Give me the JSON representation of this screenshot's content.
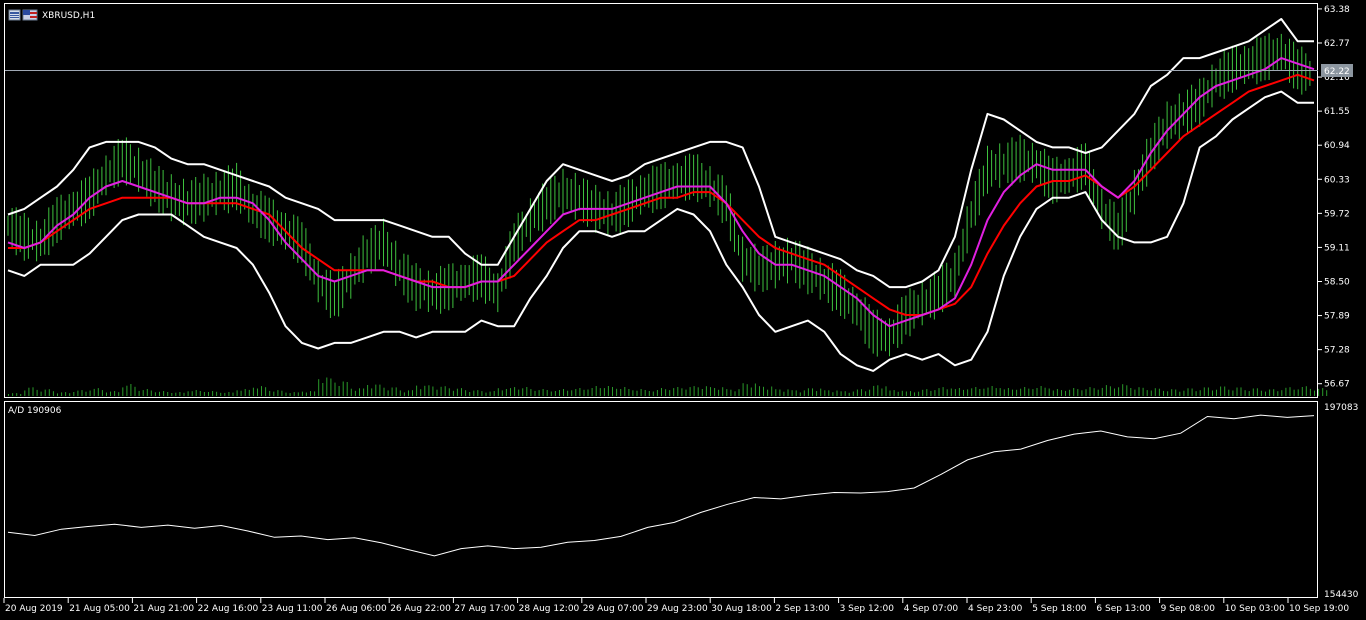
{
  "window": {
    "title": "XBRUSD,H1",
    "icon_left": "chart-window-icon",
    "icon_right": "chart-window-icon"
  },
  "price_panel": {
    "current_price_label": "62.22",
    "y_ticks": [
      "63.38",
      "62.77",
      "62.16",
      "61.55",
      "60.94",
      "60.33",
      "59.72",
      "59.11",
      "58.50",
      "57.89",
      "57.28",
      "56.67"
    ],
    "y_range": [
      56.45,
      63.45
    ]
  },
  "indicator_panel": {
    "label": "A/D 190906",
    "y_top": "197083",
    "y_bottom": "154430"
  },
  "x_axis": {
    "labels": [
      "20 Aug 2019",
      "21 Aug 05:00",
      "21 Aug 21:00",
      "22 Aug 16:00",
      "23 Aug 11:00",
      "26 Aug 06:00",
      "26 Aug 22:00",
      "27 Aug 17:00",
      "28 Aug 12:00",
      "29 Aug 07:00",
      "29 Aug 23:00",
      "30 Aug 18:00",
      "2 Sep 13:00",
      "3 Sep 12:00",
      "4 Sep 07:00",
      "4 Sep 23:00",
      "5 Sep 18:00",
      "6 Sep 13:00",
      "9 Sep 08:00",
      "10 Sep 03:00",
      "10 Sep 19:00"
    ]
  },
  "colors": {
    "background": "#000000",
    "candle": "#3ec13e",
    "bollinger": "#ffffff",
    "ma_fast": "#e020e0",
    "ma_slow": "#ff0000",
    "volume": "#2a9a2a",
    "grid_line": "#9fa8b4",
    "price_tag": "#8c96a0",
    "text": "#ffffff"
  },
  "chart_data": {
    "type": "line",
    "symbol": "XBRUSD",
    "timeframe": "H1",
    "close": [
      59.5,
      59.3,
      59.2,
      59.6,
      59.8,
      60.0,
      60.4,
      60.7,
      60.5,
      60.2,
      60.0,
      59.9,
      60.0,
      60.1,
      60.2,
      59.8,
      59.6,
      59.4,
      59.2,
      58.5,
      58.2,
      58.6,
      59.0,
      59.2,
      58.7,
      58.4,
      58.3,
      58.4,
      58.5,
      58.6,
      58.3,
      59.2,
      59.6,
      59.9,
      60.1,
      60.0,
      59.8,
      59.7,
      59.9,
      60.1,
      60.2,
      60.3,
      60.4,
      60.2,
      59.9,
      58.9,
      58.7,
      58.8,
      58.9,
      58.7,
      58.5,
      58.3,
      58.0,
      57.6,
      57.5,
      57.9,
      58.1,
      58.3,
      58.6,
      59.7,
      60.5,
      60.6,
      60.7,
      60.6,
      60.3,
      60.4,
      60.6,
      59.8,
      59.4,
      60.1,
      60.8,
      61.3,
      61.5,
      61.7,
      62.1,
      62.3,
      62.4,
      62.5,
      62.6,
      62.3,
      62.2
    ],
    "bollinger_upper": [
      59.7,
      59.8,
      60.0,
      60.2,
      60.5,
      60.9,
      61.0,
      61.0,
      61.0,
      60.9,
      60.7,
      60.6,
      60.6,
      60.5,
      60.4,
      60.3,
      60.2,
      60.0,
      59.9,
      59.8,
      59.6,
      59.6,
      59.6,
      59.6,
      59.5,
      59.4,
      59.3,
      59.3,
      59.0,
      58.8,
      58.8,
      59.3,
      59.8,
      60.3,
      60.6,
      60.5,
      60.4,
      60.3,
      60.4,
      60.6,
      60.7,
      60.8,
      60.9,
      61.0,
      61.0,
      60.9,
      60.2,
      59.3,
      59.2,
      59.1,
      59.0,
      58.9,
      58.7,
      58.6,
      58.4,
      58.4,
      58.5,
      58.7,
      59.3,
      60.5,
      61.5,
      61.4,
      61.2,
      61.0,
      60.9,
      60.9,
      60.8,
      60.9,
      61.2,
      61.5,
      62.0,
      62.2,
      62.5,
      62.5,
      62.6,
      62.7,
      62.8,
      63.0,
      63.2,
      62.8,
      62.8
    ],
    "bollinger_lower": [
      58.7,
      58.6,
      58.8,
      58.8,
      58.8,
      59.0,
      59.3,
      59.6,
      59.7,
      59.7,
      59.7,
      59.5,
      59.3,
      59.2,
      59.1,
      58.8,
      58.3,
      57.7,
      57.4,
      57.3,
      57.4,
      57.4,
      57.5,
      57.6,
      57.6,
      57.5,
      57.6,
      57.6,
      57.6,
      57.8,
      57.7,
      57.7,
      58.2,
      58.6,
      59.1,
      59.4,
      59.4,
      59.3,
      59.4,
      59.4,
      59.6,
      59.8,
      59.7,
      59.4,
      58.8,
      58.4,
      57.9,
      57.6,
      57.7,
      57.8,
      57.6,
      57.2,
      57.0,
      56.9,
      57.1,
      57.2,
      57.1,
      57.2,
      57.0,
      57.1,
      57.6,
      58.6,
      59.3,
      59.8,
      60.0,
      60.0,
      60.1,
      59.6,
      59.3,
      59.2,
      59.2,
      59.3,
      59.9,
      60.9,
      61.1,
      61.4,
      61.6,
      61.8,
      61.9,
      61.7,
      61.7
    ],
    "ma_fast": [
      59.2,
      59.1,
      59.2,
      59.5,
      59.7,
      60.0,
      60.2,
      60.3,
      60.2,
      60.1,
      60.0,
      59.9,
      59.9,
      60.0,
      60.0,
      59.9,
      59.6,
      59.2,
      58.9,
      58.6,
      58.5,
      58.6,
      58.7,
      58.7,
      58.6,
      58.5,
      58.4,
      58.4,
      58.4,
      58.5,
      58.5,
      58.8,
      59.1,
      59.4,
      59.7,
      59.8,
      59.8,
      59.8,
      59.9,
      60.0,
      60.1,
      60.2,
      60.2,
      60.2,
      59.9,
      59.4,
      59.0,
      58.8,
      58.8,
      58.7,
      58.6,
      58.4,
      58.2,
      57.9,
      57.7,
      57.8,
      57.9,
      58.0,
      58.2,
      58.8,
      59.6,
      60.1,
      60.4,
      60.6,
      60.5,
      60.5,
      60.5,
      60.2,
      60.0,
      60.3,
      60.8,
      61.2,
      61.5,
      61.8,
      62.0,
      62.1,
      62.2,
      62.3,
      62.5,
      62.4,
      62.3
    ],
    "ma_slow": [
      59.1,
      59.1,
      59.2,
      59.4,
      59.6,
      59.8,
      59.9,
      60.0,
      60.0,
      60.0,
      60.0,
      59.9,
      59.9,
      59.9,
      59.9,
      59.8,
      59.7,
      59.4,
      59.1,
      58.9,
      58.7,
      58.7,
      58.7,
      58.7,
      58.6,
      58.5,
      58.5,
      58.4,
      58.4,
      58.5,
      58.5,
      58.6,
      58.9,
      59.2,
      59.4,
      59.6,
      59.6,
      59.7,
      59.8,
      59.9,
      60.0,
      60.0,
      60.1,
      60.1,
      59.9,
      59.6,
      59.3,
      59.1,
      59.0,
      58.9,
      58.8,
      58.6,
      58.4,
      58.2,
      58.0,
      57.9,
      57.9,
      58.0,
      58.1,
      58.4,
      59.0,
      59.5,
      59.9,
      60.2,
      60.3,
      60.3,
      60.4,
      60.2,
      60.0,
      60.2,
      60.5,
      60.8,
      61.1,
      61.3,
      61.5,
      61.7,
      61.9,
      62.0,
      62.1,
      62.2,
      62.1
    ],
    "volume": [
      3,
      9,
      7,
      4,
      6,
      8,
      5,
      12,
      7,
      5,
      4,
      6,
      5,
      4,
      7,
      10,
      6,
      4,
      5,
      19,
      15,
      8,
      12,
      9,
      6,
      11,
      10,
      8,
      6,
      5,
      8,
      9,
      7,
      6,
      7,
      8,
      10,
      9,
      7,
      6,
      8,
      9,
      10,
      9,
      7,
      13,
      10,
      7,
      6,
      8,
      6,
      5,
      7,
      11,
      6,
      5,
      7,
      9,
      8,
      9,
      10,
      8,
      9,
      10,
      7,
      8,
      9,
      11,
      12,
      9,
      8,
      7,
      8,
      9,
      10,
      9,
      8,
      7,
      9,
      10,
      8
    ],
    "ad": [
      168500,
      167800,
      169200,
      169800,
      170300,
      169600,
      170100,
      169400,
      170000,
      168800,
      167400,
      167700,
      166900,
      167300,
      166200,
      164700,
      163300,
      164900,
      165500,
      164900,
      165200,
      166300,
      166700,
      167600,
      169600,
      170700,
      172900,
      174700,
      176200,
      175900,
      176700,
      177300,
      177200,
      177500,
      178300,
      181300,
      184500,
      186300,
      186900,
      188800,
      190200,
      190900,
      189600,
      189200,
      190400,
      194100,
      193600,
      194400,
      193900,
      194300
    ],
    "ylim": [
      56.45,
      63.45
    ],
    "ad_range": [
      154430,
      197083
    ]
  }
}
